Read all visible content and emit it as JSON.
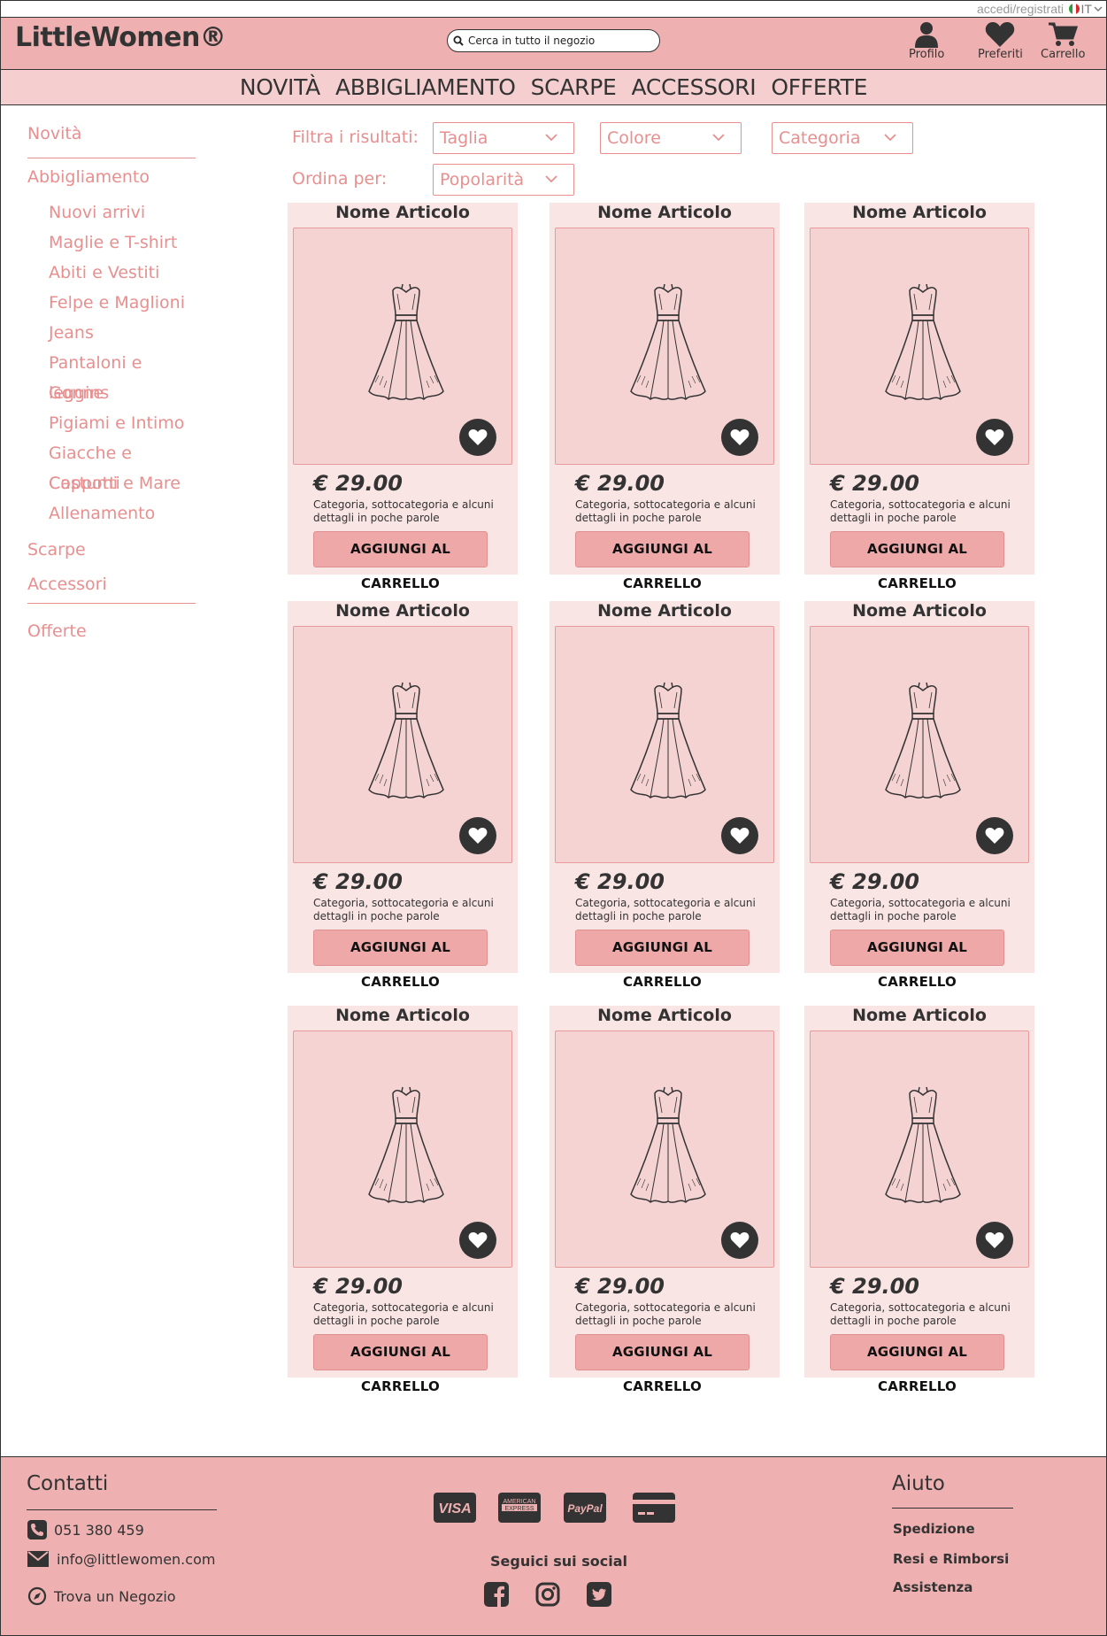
{
  "topbar": {
    "login": "accedi/registrati",
    "lang": "IT"
  },
  "header": {
    "logo": "LittleWomen®",
    "search_placeholder": "Cerca in tutto il negozio",
    "profile": "Profilo",
    "favorites": "Preferiti",
    "cart": "Carrello"
  },
  "nav": [
    "NOVITÀ",
    "ABBIGLIAMENTO",
    "SCARPE",
    "ACCESSORI",
    "OFFERTE"
  ],
  "sidebar": {
    "novita": "Novità",
    "abbigliamento": "Abbigliamento",
    "sub": [
      "Nuovi arrivi",
      "Maglie e T-shirt",
      "Abiti e Vestiti",
      "Felpe e Maglioni",
      "Jeans",
      "Pantaloni e leggins",
      "Gonne",
      "Pigiami e Intimo",
      "Giacche e Cappotti",
      "Costumi e Mare",
      "Allenamento"
    ],
    "scarpe": "Scarpe",
    "accessori": "Accessori",
    "offerte": "Offerte"
  },
  "filters": {
    "filter_label": "Filtra i risultati:",
    "size": "Taglia",
    "color": "Colore",
    "category": "Categoria",
    "sort_label": "Ordina per:",
    "sort": "Popolarità"
  },
  "products": [
    {
      "name": "Nome Articolo",
      "price": "€ 29.00",
      "desc": "Categoria, sottocategoria e alcuni dettagli in poche parole",
      "button": "AGGIUNGI AL CARRELLO"
    },
    {
      "name": "Nome Articolo",
      "price": "€ 29.00",
      "desc": "Categoria, sottocategoria e alcuni dettagli in poche parole",
      "button": "AGGIUNGI AL CARRELLO"
    },
    {
      "name": "Nome Articolo",
      "price": "€ 29.00",
      "desc": "Categoria, sottocategoria e alcuni dettagli in poche parole",
      "button": "AGGIUNGI AL CARRELLO"
    },
    {
      "name": "Nome Articolo",
      "price": "€ 29.00",
      "desc": "Categoria, sottocategoria e alcuni dettagli in poche parole",
      "button": "AGGIUNGI AL CARRELLO"
    },
    {
      "name": "Nome Articolo",
      "price": "€ 29.00",
      "desc": "Categoria, sottocategoria e alcuni dettagli in poche parole",
      "button": "AGGIUNGI AL CARRELLO"
    },
    {
      "name": "Nome Articolo",
      "price": "€ 29.00",
      "desc": "Categoria, sottocategoria e alcuni dettagli in poche parole",
      "button": "AGGIUNGI AL CARRELLO"
    },
    {
      "name": "Nome Articolo",
      "price": "€ 29.00",
      "desc": "Categoria, sottocategoria e alcuni dettagli in poche parole",
      "button": "AGGIUNGI AL CARRELLO"
    },
    {
      "name": "Nome Articolo",
      "price": "€ 29.00",
      "desc": "Categoria, sottocategoria e alcuni dettagli in poche parole",
      "button": "AGGIUNGI AL CARRELLO"
    },
    {
      "name": "Nome Articolo",
      "price": "€ 29.00",
      "desc": "Categoria, sottocategoria e alcuni dettagli in poche parole",
      "button": "AGGIUNGI AL CARRELLO"
    }
  ],
  "footer": {
    "contacts_title": "Contatti",
    "phone": "051 380 459",
    "email": "info@littlewomen.com",
    "store": "Trova un Negozio",
    "payments": [
      "VISA",
      "AMERICAN EXPRESS",
      "PayPal",
      "card-icon"
    ],
    "social_title": "Seguici sui social",
    "socials": [
      "facebook-icon",
      "instagram-icon",
      "twitter-icon"
    ],
    "help_title": "Aiuto",
    "help": [
      "Spedizione",
      "Resi e Rimborsi",
      "Assistenza"
    ]
  },
  "colors": {
    "header_bg": "#eeb0b0",
    "nav_bg": "#f5cfd0",
    "accent": "#e88f8f",
    "card_bg": "#fae5e5",
    "image_bg": "#f5d3d3",
    "button_bg": "#efa8a8",
    "dark": "#333333"
  }
}
